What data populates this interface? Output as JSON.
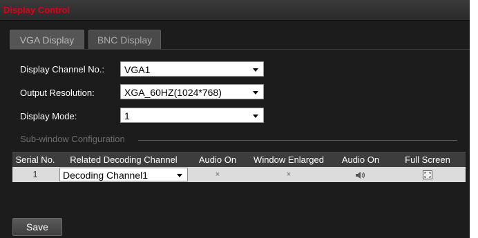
{
  "panel": {
    "title": "Display Control"
  },
  "tabs": [
    {
      "label": "VGA Display",
      "active": true
    },
    {
      "label": "BNC Display",
      "active": false
    }
  ],
  "form": {
    "channel": {
      "label": "Display Channel No.:",
      "value": "VGA1"
    },
    "resolution": {
      "label": "Output Resolution:",
      "value": "XGA_60HZ(1024*768)"
    },
    "mode": {
      "label": "Display Mode:",
      "value": "1"
    }
  },
  "subwindow": {
    "title": "Sub-window Configuration",
    "headers": [
      "Serial No.",
      "Related Decoding Channel",
      "Audio On",
      "Window Enlarged",
      "Audio On",
      "Full Screen"
    ],
    "rows": [
      {
        "serial": "1",
        "channel": "Decoding Channel1",
        "audio_on": "×",
        "window_enlarged": "×",
        "audio_icon": "speaker-icon",
        "fullscreen_icon": "fullscreen-icon"
      }
    ]
  },
  "buttons": {
    "save": "Save"
  },
  "colors": {
    "title_red": "#e0001a",
    "panel_bg": "#1c1c1c",
    "row_bg": "#dcdcdc"
  }
}
